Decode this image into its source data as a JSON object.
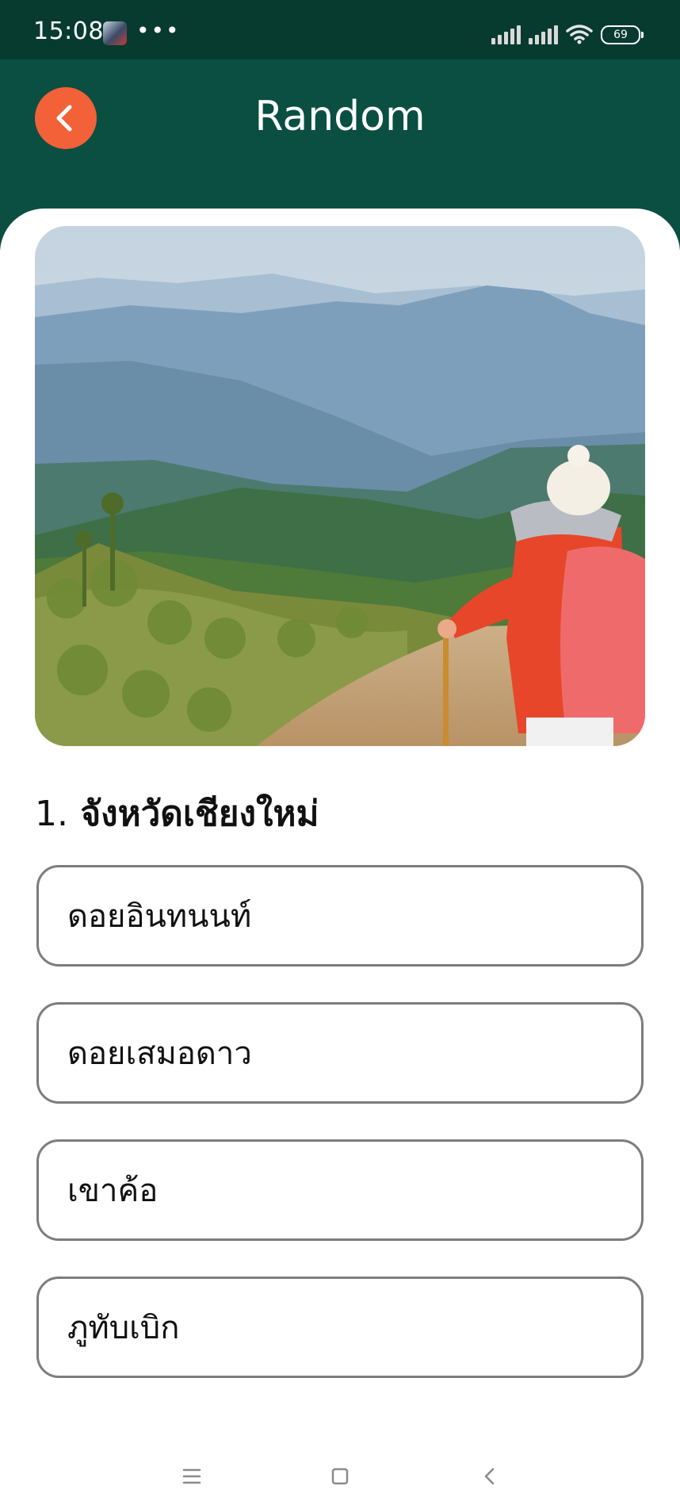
{
  "status_bar": {
    "time": "15:08",
    "dots": "•••",
    "battery": "69",
    "icons": [
      "app-notification-icon",
      "signal-icon",
      "signal-icon",
      "wifi-icon",
      "battery-icon"
    ]
  },
  "header": {
    "title": "Random",
    "back_icon": "chevron-left-icon",
    "back_color": "#f26138",
    "background": "#0a4f42"
  },
  "question": {
    "number": "1.",
    "text": "จังหวัดเชียงใหม่"
  },
  "options": [
    {
      "label": "ดอยอินทนนท์"
    },
    {
      "label": "ดอยเสมอดาว"
    },
    {
      "label": "เขาค้อ"
    },
    {
      "label": "ภูทับเบิก"
    }
  ],
  "nav_bar": {
    "icons": [
      "menu-icon",
      "home-square-icon",
      "back-chevron-icon"
    ]
  }
}
